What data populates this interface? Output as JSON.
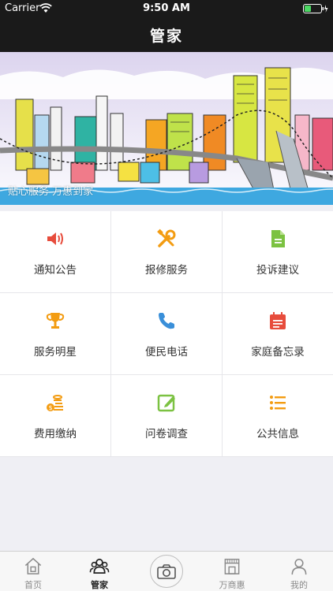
{
  "status_bar": {
    "carrier": "Carrier",
    "time": "9:50 AM"
  },
  "nav": {
    "title": "管家"
  },
  "banner": {
    "caption": "贴心服务 万惠到家"
  },
  "grid": [
    {
      "label": "通知公告",
      "icon": "speaker-icon",
      "color": "#e74c3c"
    },
    {
      "label": "报修服务",
      "icon": "tools-icon",
      "color": "#f39c12"
    },
    {
      "label": "投诉建议",
      "icon": "document-icon",
      "color": "#7cc242"
    },
    {
      "label": "服务明星",
      "icon": "trophy-icon",
      "color": "#f39c12"
    },
    {
      "label": "便民电话",
      "icon": "phone-icon",
      "color": "#3a8fd9"
    },
    {
      "label": "家庭备忘录",
      "icon": "calendar-icon",
      "color": "#e74c3c"
    },
    {
      "label": "费用缴纳",
      "icon": "coins-icon",
      "color": "#f39c12"
    },
    {
      "label": "问卷调查",
      "icon": "edit-icon",
      "color": "#7cc242"
    },
    {
      "label": "公共信息",
      "icon": "list-icon",
      "color": "#f39c12"
    }
  ],
  "tabs": [
    {
      "label": "首页",
      "icon": "home-icon"
    },
    {
      "label": "管家",
      "icon": "people-icon",
      "active": true
    },
    {
      "label": "",
      "icon": "camera-icon"
    },
    {
      "label": "万商惠",
      "icon": "shop-icon"
    },
    {
      "label": "我的",
      "icon": "user-icon"
    }
  ]
}
